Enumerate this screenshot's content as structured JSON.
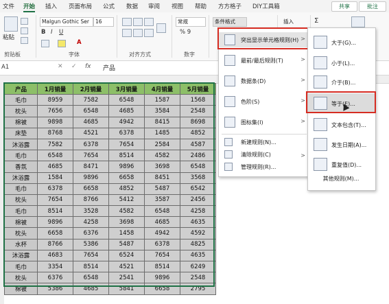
{
  "tabs": [
    "文件",
    "开始",
    "插入",
    "页面布局",
    "公式",
    "数据",
    "审阅",
    "视图",
    "帮助",
    "方方格子",
    "DIY工具箱"
  ],
  "active_tab": "开始",
  "share_label": "共享",
  "comment_label": "批注",
  "ribbon": {
    "paste_label": "粘贴",
    "clipboard_label": "剪贴板",
    "font_name": "Malgun Gothic Ser",
    "font_size": "16",
    "font_group_label": "字体",
    "align_group_label": "对齐方式",
    "number_format": "常规",
    "number_group_label": "数字",
    "cf_button": "条件格式",
    "insert_button": "插入",
    "sum_symbol": "Σ"
  },
  "formula_bar": {
    "name_box": "A1",
    "content": "产品"
  },
  "table": {
    "headers": [
      "产品",
      "1月销量",
      "2月销量",
      "3月销量",
      "4月销量",
      "5月销量"
    ],
    "rows": [
      [
        "毛巾",
        "8959",
        "7582",
        "6548",
        "1587",
        "1568"
      ],
      [
        "枕头",
        "7656",
        "6548",
        "4685",
        "3584",
        "2548"
      ],
      [
        "棉被",
        "9898",
        "4685",
        "4942",
        "8415",
        "8698"
      ],
      [
        "床垫",
        "8768",
        "4521",
        "6378",
        "1485",
        "4852"
      ],
      [
        "沐浴露",
        "7582",
        "6378",
        "7654",
        "2584",
        "4587"
      ],
      [
        "毛巾",
        "6548",
        "7654",
        "8514",
        "4582",
        "2486"
      ],
      [
        "香氛",
        "4685",
        "8471",
        "9896",
        "3698",
        "6548"
      ],
      [
        "沐浴露",
        "1584",
        "9896",
        "6658",
        "8451",
        "3568"
      ],
      [
        "毛巾",
        "6378",
        "6658",
        "4852",
        "5487",
        "6542"
      ],
      [
        "枕头",
        "7654",
        "8766",
        "5412",
        "3587",
        "2456"
      ],
      [
        "毛巾",
        "8514",
        "3528",
        "4582",
        "6548",
        "4258"
      ],
      [
        "棉被",
        "9896",
        "4258",
        "3698",
        "4685",
        "4635"
      ],
      [
        "枕头",
        "6658",
        "6376",
        "1458",
        "4942",
        "4592"
      ],
      [
        "水杯",
        "8766",
        "5386",
        "5487",
        "6378",
        "4825"
      ],
      [
        "沐浴露",
        "4683",
        "7654",
        "6524",
        "7654",
        "4635"
      ],
      [
        "毛巾",
        "3354",
        "8514",
        "4521",
        "8514",
        "6249"
      ],
      [
        "枕头",
        "6376",
        "6548",
        "2541",
        "9896",
        "2548"
      ],
      [
        "棉被",
        "5386",
        "4685",
        "5841",
        "6658",
        "2795"
      ]
    ]
  },
  "cf_menu": {
    "items": [
      {
        "label": "突出显示单元格规则(H)",
        "arrow": ">",
        "icon": "highlight-rules-icon"
      },
      {
        "label": "最前/最后规则(T)",
        "arrow": ">",
        "icon": "top-bottom-icon"
      },
      {
        "label": "数据条(D)",
        "arrow": ">",
        "icon": "data-bar-icon"
      },
      {
        "label": "色阶(S)",
        "arrow": ">",
        "icon": "color-scale-icon"
      },
      {
        "label": "图标集(I)",
        "arrow": ">",
        "icon": "icon-set-icon"
      }
    ],
    "footer": [
      {
        "label": "新建规则(N)...",
        "icon": "new-rule-icon"
      },
      {
        "label": "清除规则(C)",
        "arrow": ">",
        "icon": "clear-rule-icon"
      },
      {
        "label": "管理规则(R)...",
        "icon": "manage-rule-icon"
      }
    ]
  },
  "sub_menu": {
    "items": [
      {
        "label": "大于(G)...",
        "icon": "greater-than-icon"
      },
      {
        "label": "小于(L)...",
        "icon": "less-than-icon"
      },
      {
        "label": "介于(B)...",
        "icon": "between-icon"
      },
      {
        "label": "等于(E)...",
        "icon": "equal-to-icon"
      },
      {
        "label": "文本包含(T)...",
        "icon": "text-contains-icon"
      },
      {
        "label": "发生日期(A)...",
        "icon": "date-occurring-icon"
      },
      {
        "label": "重复值(D)...",
        "icon": "duplicate-values-icon"
      }
    ],
    "more": "其他规则(M)..."
  },
  "colors": {
    "accent": "#1e7145",
    "header_fill": "#8dbf68",
    "cell_fill": "#cfcfcf",
    "callout": "#d62c22"
  }
}
